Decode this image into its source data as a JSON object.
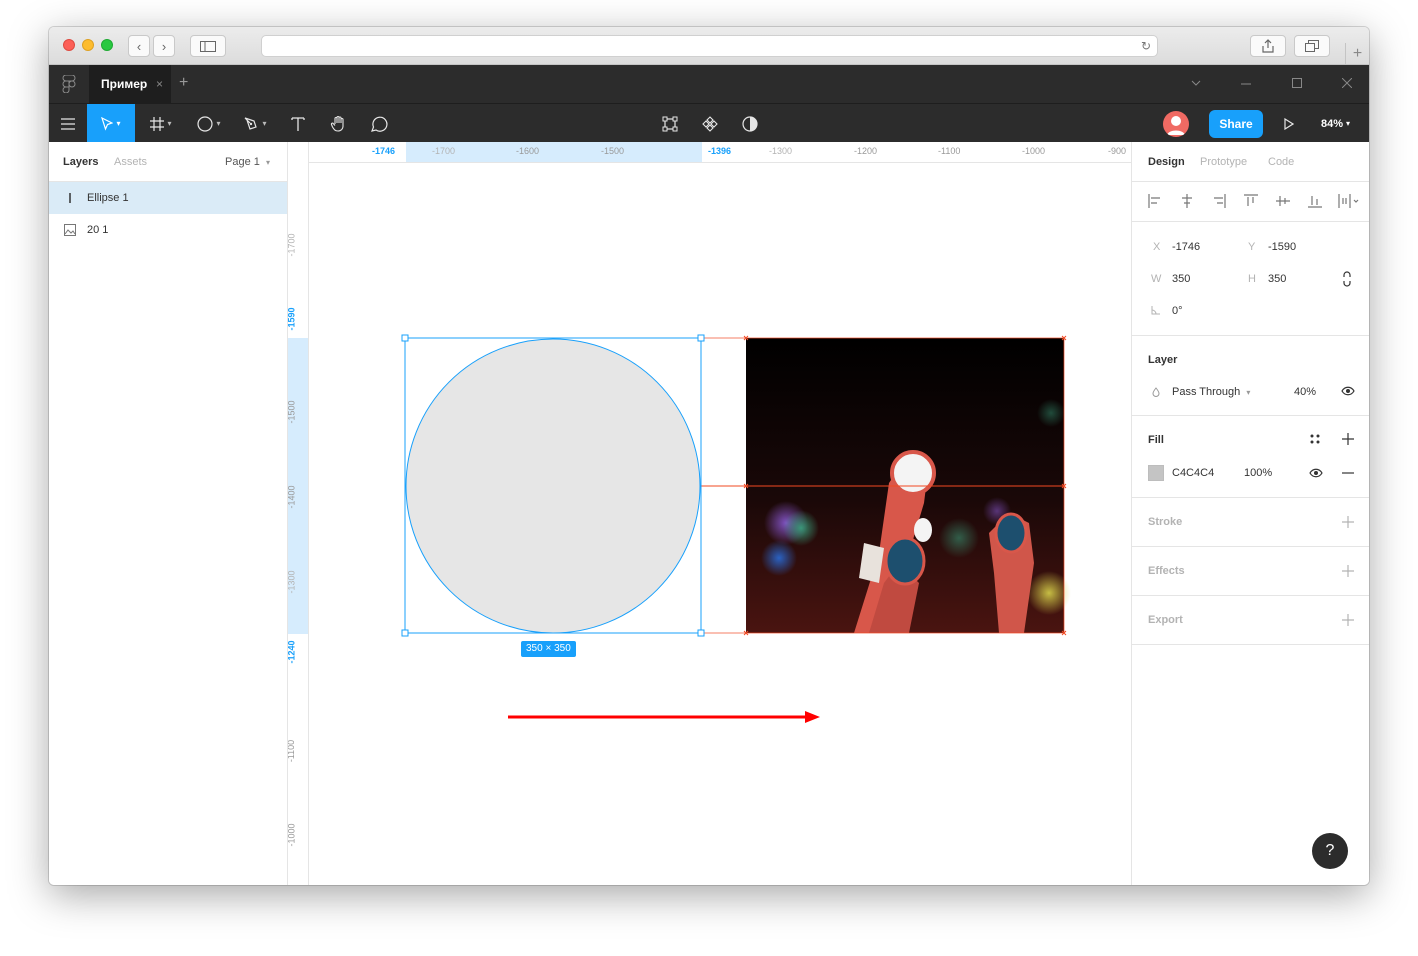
{
  "browser": {
    "reload_glyph": "↻",
    "back_glyph": "‹",
    "forward_glyph": "›",
    "new_tab_glyph": "+"
  },
  "tabbar": {
    "file_tab_label": "Пример",
    "close_glyph": "×",
    "add_tab_glyph": "+"
  },
  "toolbar": {
    "share_label": "Share",
    "zoom_label": "84%"
  },
  "left_panel": {
    "tabs": [
      "Layers",
      "Assets"
    ],
    "page_label": "Page 1",
    "layers": [
      {
        "label": "Ellipse 1",
        "icon": "ellipse-layer-icon",
        "selected": true
      },
      {
        "label": "20 1",
        "icon": "image-layer-icon",
        "selected": false
      }
    ]
  },
  "rulers": {
    "horizontal": [
      "-1746",
      "-1700",
      "-1600",
      "-1500",
      "-1396",
      "-1300",
      "-1200",
      "-1100",
      "-1000",
      "-900"
    ],
    "vertical": [
      "-1700",
      "-1590",
      "-1500",
      "-1400",
      "-1300",
      "-1240",
      "-1100",
      "-1000"
    ]
  },
  "canvas": {
    "size_badge": "350 × 350",
    "selection_color": "#18a0fb",
    "ellipse_fill": "#e6e6e6",
    "guide_color": "#f24822",
    "arrow_color": "#ff0000"
  },
  "right_panel": {
    "tabs": [
      "Design",
      "Prototype",
      "Code"
    ],
    "x_label": "X",
    "x_value": "-1746",
    "y_label": "Y",
    "y_value": "-1590",
    "w_label": "W",
    "w_value": "350",
    "h_label": "H",
    "h_value": "350",
    "rotation_value": "0°",
    "layer_title": "Layer",
    "blend_mode": "Pass Through",
    "opacity": "40%",
    "fill_title": "Fill",
    "fill_hex": "C4C4C4",
    "fill_opacity": "100%",
    "fill_swatch": "#c4c4c4",
    "stroke_title": "Stroke",
    "effects_title": "Effects",
    "export_title": "Export"
  },
  "help_label": "?"
}
